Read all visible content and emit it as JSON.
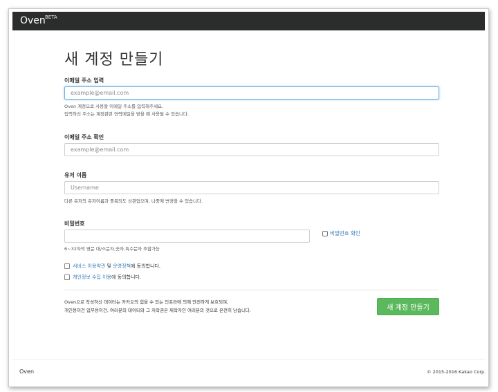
{
  "navbar": {
    "brand": "Oven",
    "badge": "BETA"
  },
  "page": {
    "title": "새 계정 만들기"
  },
  "email": {
    "label": "이메일 주소 입력",
    "placeholder": "example@email.com",
    "help_line1": "Oven 계정으로 사용할 이메일 주소를 입력해주세요.",
    "help_line2": "입력하신 주소는 계정관련 연락메일을 받을 때 사용될 수 있습니다."
  },
  "email_confirm": {
    "label": "이메일 주소 확인",
    "placeholder": "example@email.com"
  },
  "username": {
    "label": "유저 이름",
    "placeholder": "Username",
    "help": "다른 유저의 유저이름과 중복되도 상관없으며, 나중에 변경할 수 있습니다."
  },
  "password": {
    "label": "비밀번호",
    "show_label": "비밀번호 확인",
    "help": "6~32자의 영문 대/소문자,숫자,특수문자 조합가능"
  },
  "agreements": [
    {
      "link1": "서비스 이용약관",
      "mid": " 및 ",
      "link2": "운영정책",
      "suffix": "에 동의합니다."
    },
    {
      "link1": "개인정보 수집 이용",
      "suffix": "에 동의합니다."
    }
  ],
  "notice": {
    "line1": "Oven으로 작성하신 데이터는 카카오의 힘을 수 있는 인프라에 의해 안전하게 보호되며,",
    "line2": "개인용이건 업무용이건, 여러분의 데이터와 그 저작권은 제작자인 여러분의 것으로 온전히 남습니다."
  },
  "submit_label": "새 계정 만들기",
  "footer": {
    "brand": "Oven",
    "copyright": "© 2015-2016 Kakao Corp."
  },
  "colors": {
    "navbar": "#2b2c2c",
    "submit": "#5cb85c",
    "link": "#337ab7",
    "focus": "#66afe9"
  }
}
